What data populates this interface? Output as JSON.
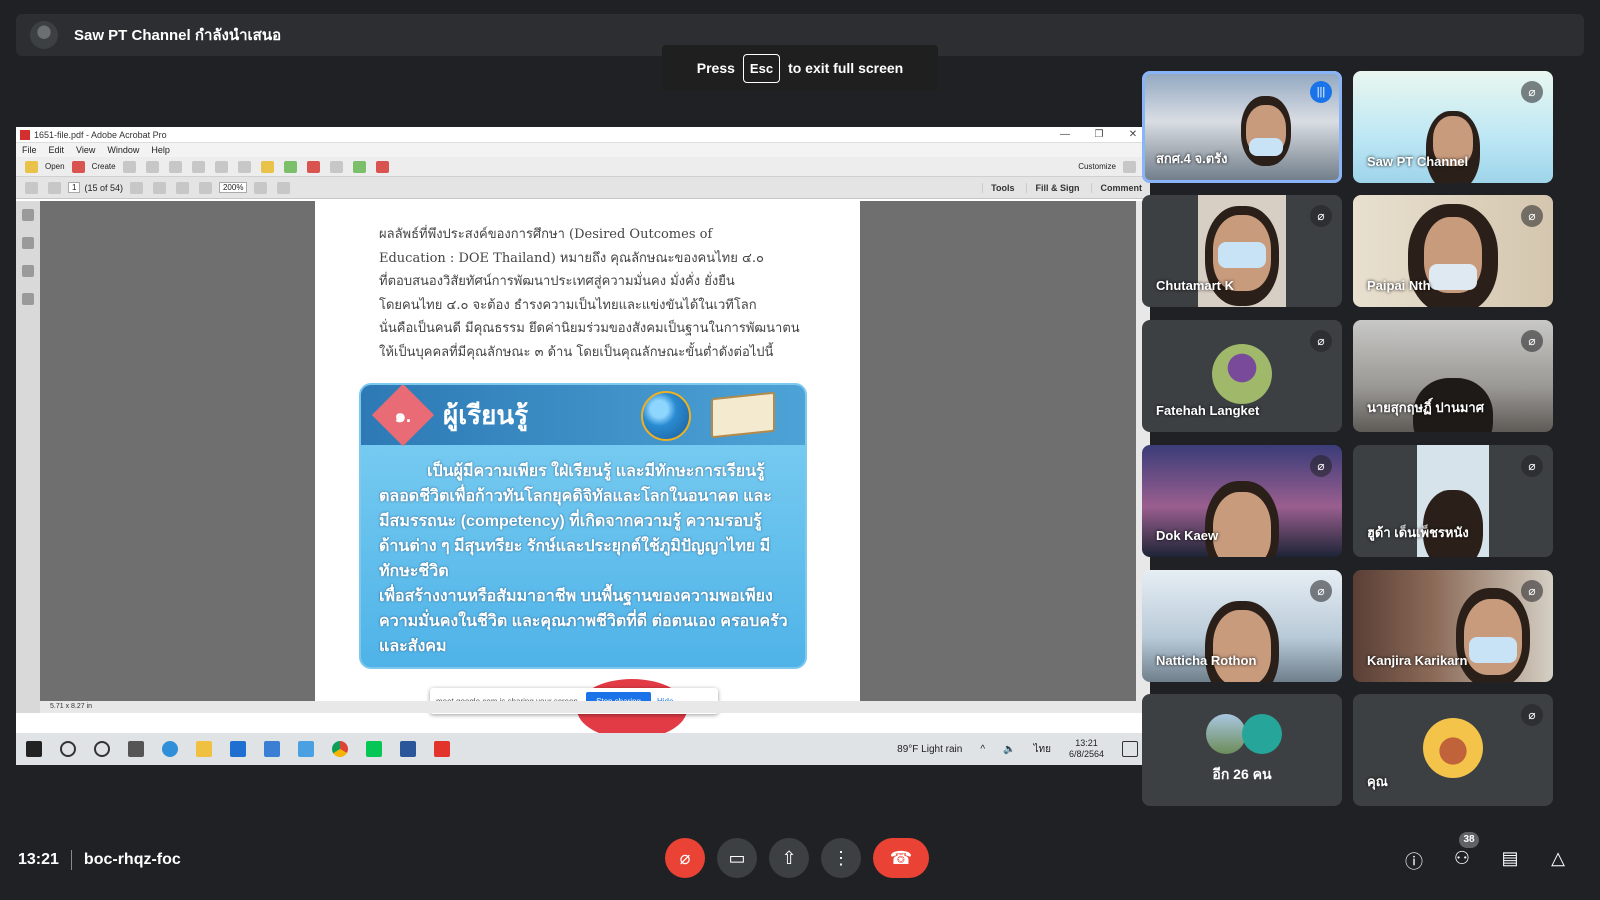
{
  "presenter": {
    "text": "Saw PT Channel กำลังนำเสนอ"
  },
  "esc_toast": {
    "press": "Press",
    "key": "Esc",
    "suffix": "to exit full screen"
  },
  "acrobat": {
    "title": "1651-file.pdf - Adobe Acrobat Pro",
    "menu": [
      "File",
      "Edit",
      "View",
      "Window",
      "Help"
    ],
    "toolbar": {
      "open": "Open",
      "create": "Create",
      "customize": "Customize"
    },
    "nav": {
      "page": "1",
      "page_of": "(15 of 54)",
      "zoom": "200%",
      "tools": "Tools",
      "fill_sign": "Fill & Sign",
      "comment": "Comment"
    },
    "page_size": "5.71 x 8.27 in"
  },
  "document": {
    "para_lines": [
      "ผลลัพธ์ที่พึงประสงค์ของการศึกษา (Desired Outcomes of",
      "Education : DOE Thailand) หมายถึง คุณลักษณะของคนไทย ๔.๐",
      "ที่ตอบสนองวิสัยทัศน์การพัฒนาประเทศสู่ความมั่นคง มั่งคั่ง ยั่งยืน",
      "โดยคนไทย ๔.๐ จะต้อง ธำรงความเป็นไทยและแข่งขันได้ในเวทีโลก",
      "นั่นคือเป็นคนดี มีคุณธรรม ยึดค่านิยมร่วมของสังคมเป็นฐานในการพัฒนาตน",
      "ให้เป็นบุคคลที่มีคุณลักษณะ ๓ ด้าน โดยเป็นคุณลักษณะขั้นต่ำดังต่อไปนี้"
    ],
    "card_number": "๑.",
    "card_title": "ผู้เรียนรู้",
    "card_lines": [
      "เป็นผู้มีความเพียร ใฝ่เรียนรู้ และมีทักษะการเรียนรู้",
      "ตลอดชีวิตเพื่อก้าวทันโลกยุคดิจิทัลและโลกในอนาคต และ",
      "มีสมรรถนะ (competency) ที่เกิดจากความรู้ ความรอบรู้",
      "ด้านต่าง ๆ มีสุนทรียะ รักษ์และประยุกต์ใช้ภูมิปัญญาไทย มีทักษะชีวิต",
      "เพื่อสร้างงานหรือสัมมาอาชีพ บนพื้นฐานของความพอเพียง",
      "ความมั่นคงในชีวิต และคุณภาพชีวิตที่ดี ต่อตนเอง ครอบครัว",
      "และสังคม"
    ]
  },
  "share_bar": {
    "text": "meet.google.com is sharing your screen.",
    "stop": "Stop sharing",
    "hide": "Hide"
  },
  "taskbar": {
    "weather": "89°F  Light rain",
    "lang": "ไทย",
    "time": "13:21",
    "date": "6/8/2564"
  },
  "participants": [
    {
      "name": "สกศ.4 จ.ตรัง",
      "state": "speaking"
    },
    {
      "name": "Saw PT Channel",
      "state": "muted"
    },
    {
      "name": "Chutamart K",
      "state": "muted"
    },
    {
      "name": "Paipai Nth",
      "state": "muted"
    },
    {
      "name": "Fatehah Langket",
      "state": "muted"
    },
    {
      "name": "นายสุกฤษฏิ์ ปานมาศ",
      "state": "muted"
    },
    {
      "name": "Dok Kaew",
      "state": "muted"
    },
    {
      "name": "ฮูด้า เด็นเพ็ชรหนัง",
      "state": "muted"
    },
    {
      "name": "Natticha Rothon",
      "state": "muted"
    },
    {
      "name": "Kanjira Karikarn",
      "state": "muted"
    }
  ],
  "others": {
    "label": "อีก 26 คน"
  },
  "self": {
    "name": "คุณ"
  },
  "meeting": {
    "time": "13:21",
    "code": "boc-rhqz-foc",
    "participant_count": "38"
  },
  "colors": {
    "background": "#202124",
    "end_call": "#ea4335",
    "speaking": "#1a73e8"
  }
}
